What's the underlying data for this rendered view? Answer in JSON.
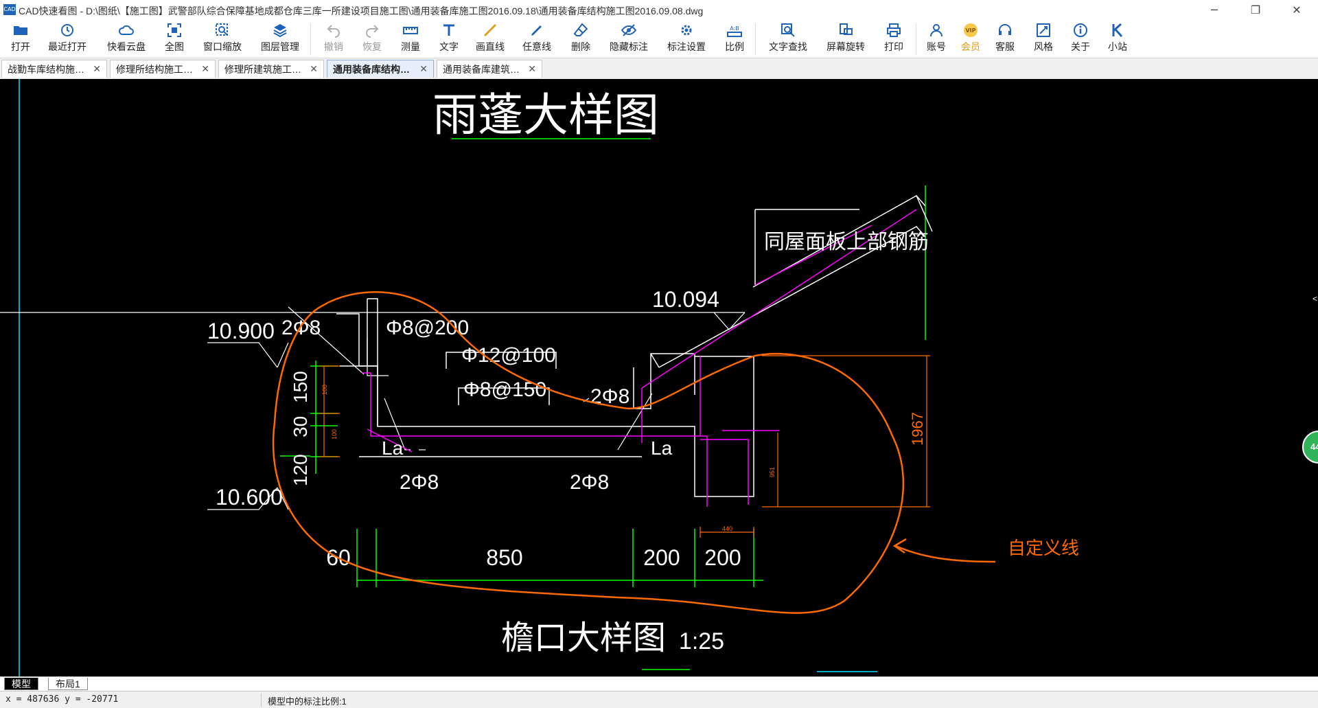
{
  "window": {
    "logo_text": "CAD",
    "title": "CAD快速看图 - D:\\图纸\\【施工图】武警部队综合保障基地成都仓库三库一所建设项目施工图\\通用装备库施工图2016.09.18\\通用装备库结构施工图2016.09.08.dwg",
    "minimize": "─",
    "restore": "❐",
    "close": "✕"
  },
  "toolbar": {
    "open": "打开",
    "recent": "最近打开",
    "cloud": "快看云盘",
    "fullview": "全图",
    "window_zoom": "窗口缩放",
    "layers": "图层管理",
    "undo": "撤销",
    "redo": "恢复",
    "measure": "测量",
    "text": "文字",
    "line": "画直线",
    "freeline": "任意线",
    "erase": "删除",
    "hide_marks": "隐藏标注",
    "mark_settings": "标注设置",
    "scale": "比例",
    "find_text": "文字查找",
    "rotate": "屏幕旋转",
    "print": "打印",
    "account": "账号",
    "vip": "会员",
    "service": "客服",
    "style": "风格",
    "about": "关于",
    "site": "小站",
    "vip_badge": "VIP",
    "scale_badge": "A:B"
  },
  "tabs": [
    {
      "label": "战勤车库结构施…",
      "close": "✕"
    },
    {
      "label": "修理所结构施工…",
      "close": "✕"
    },
    {
      "label": "修理所建筑施工…",
      "close": "✕"
    },
    {
      "label": "通用装备库结构…",
      "close": "✕",
      "active": true
    },
    {
      "label": "通用装备库建筑…",
      "close": "✕"
    }
  ],
  "drawing": {
    "title_top": "雨蓬大样图",
    "title_bottom": "檐口大样图",
    "scale_text": "1:25",
    "elev_10900": "10.900",
    "elev_10600": "10.600",
    "elev_10094": "10.094",
    "rebar_2phi8_top": "2Φ8",
    "rebar_phi8_200": "Φ8@200",
    "rebar_phi12_100": "Φ12@100",
    "rebar_phi8_150": "Φ8@150",
    "rebar_2phi8_mid": "2Φ8",
    "rebar_2phi8_bl": "2Φ8",
    "rebar_2phi8_br": "2Φ8",
    "la_left": "La",
    "la_right": "La",
    "roof_note": "同屋面板上部钢筋",
    "dim_150": "150",
    "dim_30": "30",
    "dim_120": "120",
    "dim_1967": "1967",
    "dim_60": "60",
    "dim_850": "850",
    "dim_200a": "200",
    "dim_200b": "200",
    "tiny_a": "100",
    "tiny_b": "100",
    "tiny_c": "951",
    "tiny_d": "440",
    "custom_line_label": "自定义线"
  },
  "side_badge": "44",
  "layout_tabs": {
    "model": "模型",
    "layout1": "布局1"
  },
  "status": {
    "coords": "x = 487636 y = -20771",
    "scale_text": "模型中的标注比例:1"
  },
  "colors": {
    "cad_white": "#ffffff",
    "cad_green": "#00ff00",
    "cad_magenta": "#ff00ff",
    "cad_orange": "#ff6a00",
    "cad_cyan": "#00e5ff",
    "accent_blue": "#1f63b8"
  }
}
